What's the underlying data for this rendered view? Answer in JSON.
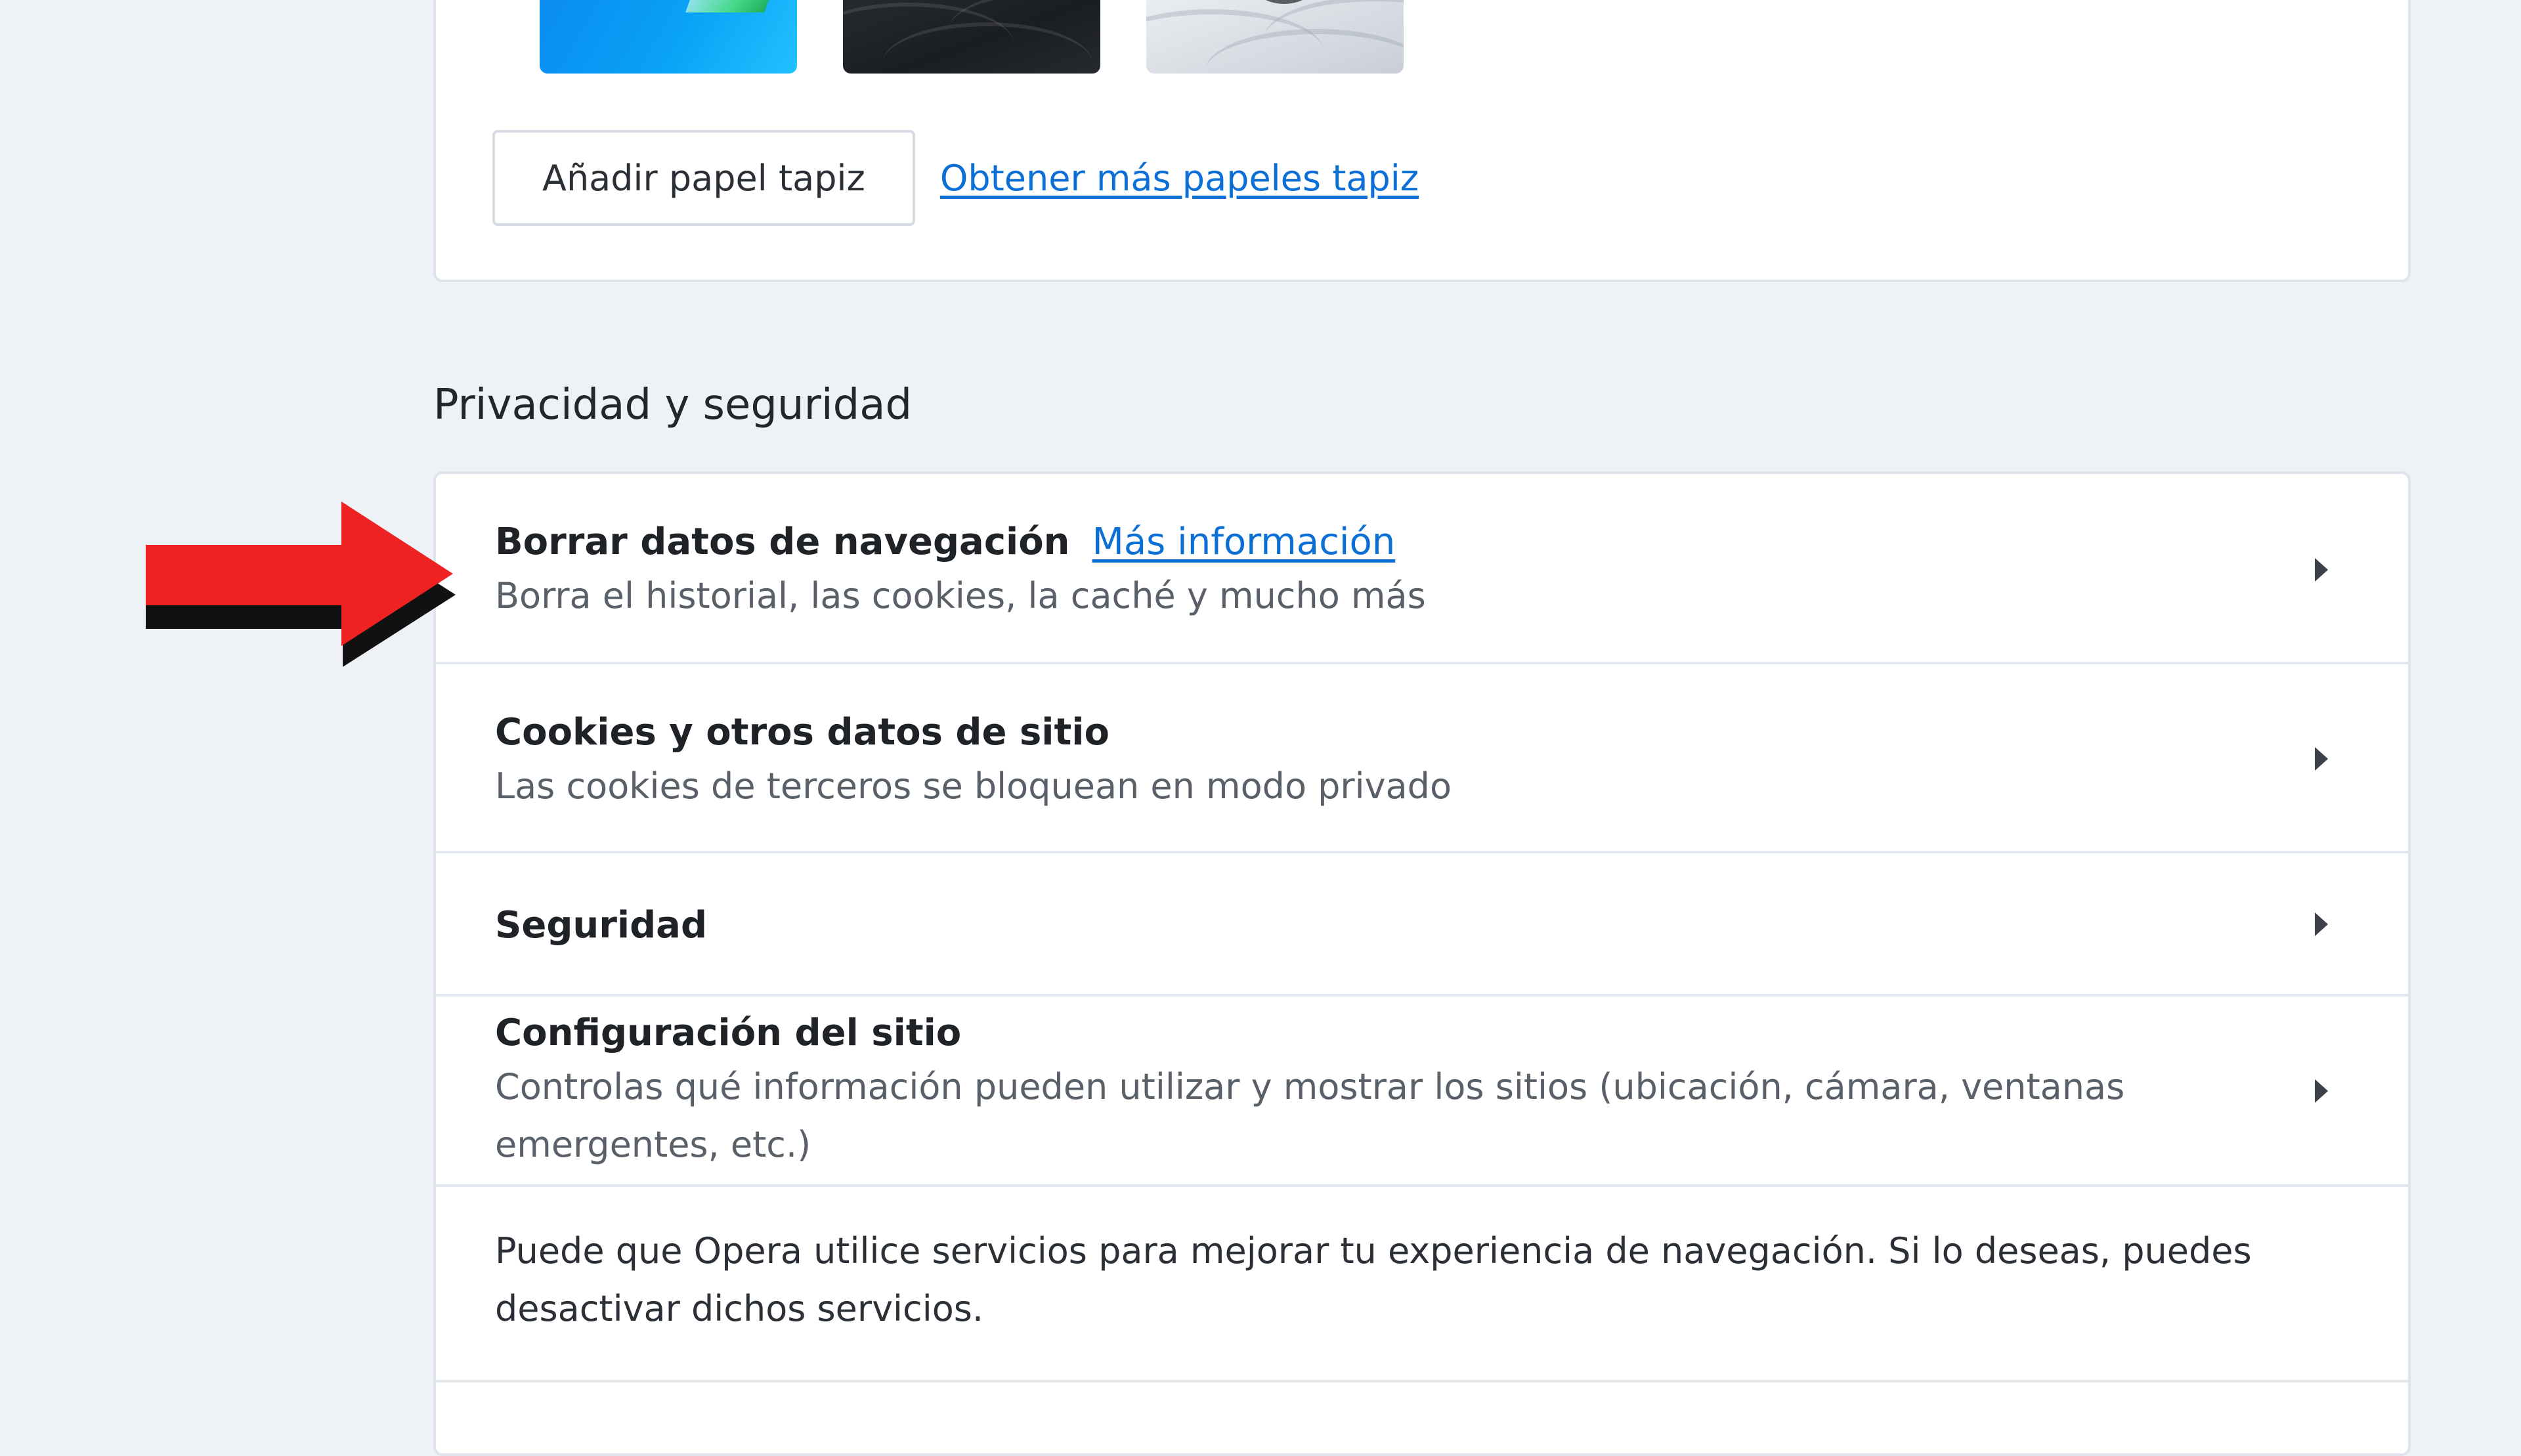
{
  "wallpapers": {
    "thumbnails": [
      {
        "name": "Azul"
      },
      {
        "name": "Oscuro"
      },
      {
        "name": "Claro"
      }
    ],
    "add_button_label": "Añadir papel tapiz",
    "more_link_label": "Obtener más papeles tapiz"
  },
  "privacy": {
    "section_title": "Privacidad y seguridad",
    "rows": [
      {
        "title": "Borrar datos de navegación",
        "link": "Más información",
        "subtitle": "Borra el historial, las cookies, la caché y mucho más"
      },
      {
        "title": "Cookies y otros datos de sitio",
        "subtitle": "Las cookies de terceros se bloquean en modo privado"
      },
      {
        "title": "Seguridad"
      },
      {
        "title": "Configuración del sitio",
        "subtitle": "Controlas qué información pueden utilizar y mostrar los sitios (ubicación, cámara, ventanas emergentes, etc.)"
      },
      {
        "body": "Puede que Opera utilice servicios para mejorar tu experiencia de navegación. Si lo deseas, puedes desactivar dichos servicios."
      }
    ]
  },
  "annotation": {
    "arrow_color": "#ee2222",
    "arrow_shadow_color": "#111111",
    "arrow_icon": "red-arrow-right-icon"
  },
  "colors": {
    "link": "#0b6fd6",
    "background": "#eef2f7"
  }
}
